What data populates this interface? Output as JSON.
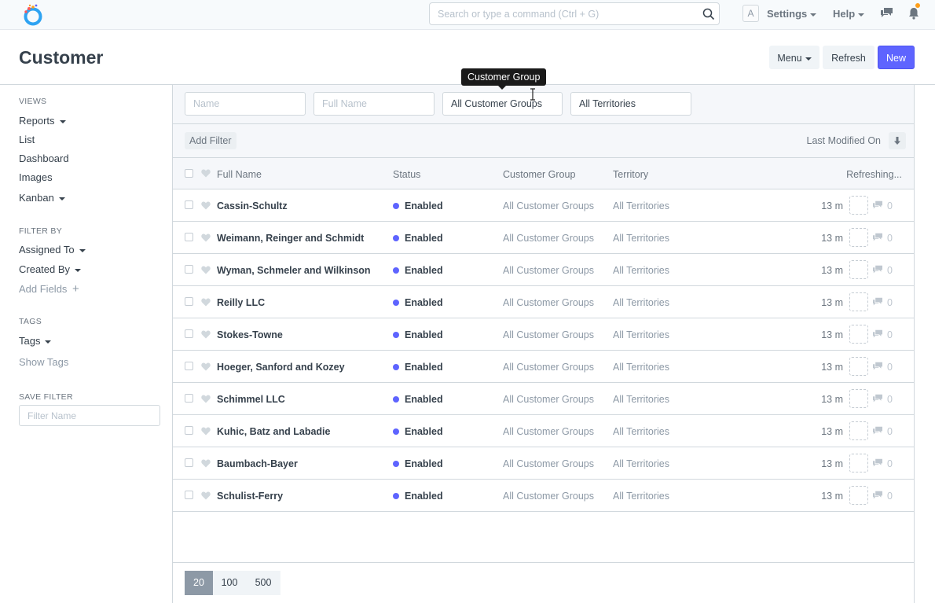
{
  "navbar": {
    "search_placeholder": "Search or type a command (Ctrl + G)",
    "avatar_letter": "A",
    "settings_label": "Settings",
    "help_label": "Help",
    "notification_dot_color": "#ff9f1a"
  },
  "page": {
    "title": "Customer",
    "menu_label": "Menu",
    "refresh_label": "Refresh",
    "new_label": "New",
    "accent_color": "#5e64ff"
  },
  "sidebar": {
    "views_heading": "VIEWS",
    "views": [
      "Reports",
      "List",
      "Dashboard",
      "Images",
      "Kanban"
    ],
    "filter_heading": "FILTER BY",
    "assigned_to": "Assigned To",
    "created_by": "Created By",
    "add_fields": "Add Fields",
    "tags_heading": "TAGS",
    "tags": "Tags",
    "show_tags": "Show Tags",
    "save_filter_heading": "SAVE FILTER",
    "filter_name_placeholder": "Filter Name"
  },
  "filters": {
    "name_placeholder": "Name",
    "full_name_placeholder": "Full Name",
    "customer_group_value": "All Customer Groups",
    "territory_value": "All Territories",
    "add_filter_label": "Add Filter",
    "sort_label": "Last Modified On"
  },
  "tooltip": "Customer Group",
  "list": {
    "columns": {
      "full_name": "Full Name",
      "status": "Status",
      "customer_group": "Customer Group",
      "territory": "Territory",
      "refreshing": "Refreshing..."
    },
    "rows": [
      {
        "name": "Cassin-Schultz",
        "status": "Enabled",
        "group": "All Customer Groups",
        "territory": "All Territories",
        "modified": "13 m",
        "comments": "0"
      },
      {
        "name": "Weimann, Reinger and Schmidt",
        "status": "Enabled",
        "group": "All Customer Groups",
        "territory": "All Territories",
        "modified": "13 m",
        "comments": "0"
      },
      {
        "name": "Wyman, Schmeler and Wilkinson",
        "status": "Enabled",
        "group": "All Customer Groups",
        "territory": "All Territories",
        "modified": "13 m",
        "comments": "0"
      },
      {
        "name": "Reilly LLC",
        "status": "Enabled",
        "group": "All Customer Groups",
        "territory": "All Territories",
        "modified": "13 m",
        "comments": "0"
      },
      {
        "name": "Stokes-Towne",
        "status": "Enabled",
        "group": "All Customer Groups",
        "territory": "All Territories",
        "modified": "13 m",
        "comments": "0"
      },
      {
        "name": "Hoeger, Sanford and Kozey",
        "status": "Enabled",
        "group": "All Customer Groups",
        "territory": "All Territories",
        "modified": "13 m",
        "comments": "0"
      },
      {
        "name": "Schimmel LLC",
        "status": "Enabled",
        "group": "All Customer Groups",
        "territory": "All Territories",
        "modified": "13 m",
        "comments": "0"
      },
      {
        "name": "Kuhic, Batz and Labadie",
        "status": "Enabled",
        "group": "All Customer Groups",
        "territory": "All Territories",
        "modified": "13 m",
        "comments": "0"
      },
      {
        "name": "Baumbach-Bayer",
        "status": "Enabled",
        "group": "All Customer Groups",
        "territory": "All Territories",
        "modified": "13 m",
        "comments": "0"
      },
      {
        "name": "Schulist-Ferry",
        "status": "Enabled",
        "group": "All Customer Groups",
        "territory": "All Territories",
        "modified": "13 m",
        "comments": "0"
      }
    ]
  },
  "paging": {
    "options": [
      "20",
      "100",
      "500"
    ],
    "selected": "20"
  }
}
